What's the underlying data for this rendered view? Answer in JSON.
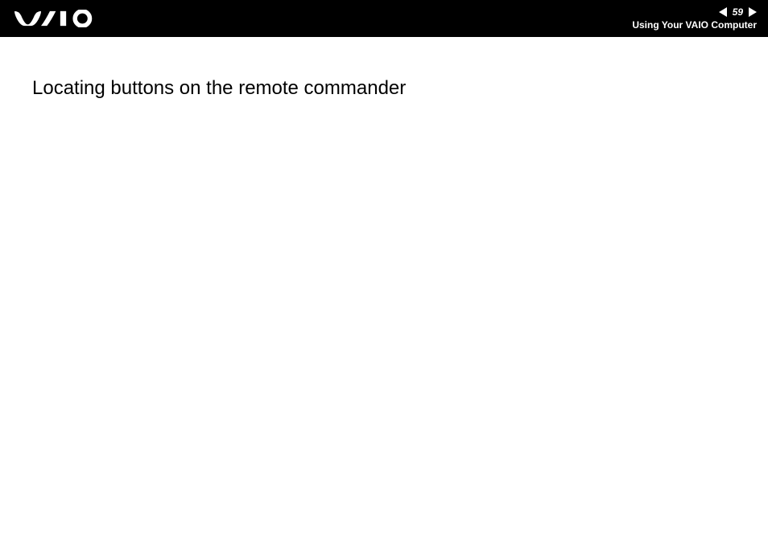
{
  "header": {
    "logo_name": "vaio-logo",
    "page_number": "59",
    "section_title": "Using Your VAIO Computer"
  },
  "content": {
    "heading": "Locating buttons on the remote commander"
  }
}
